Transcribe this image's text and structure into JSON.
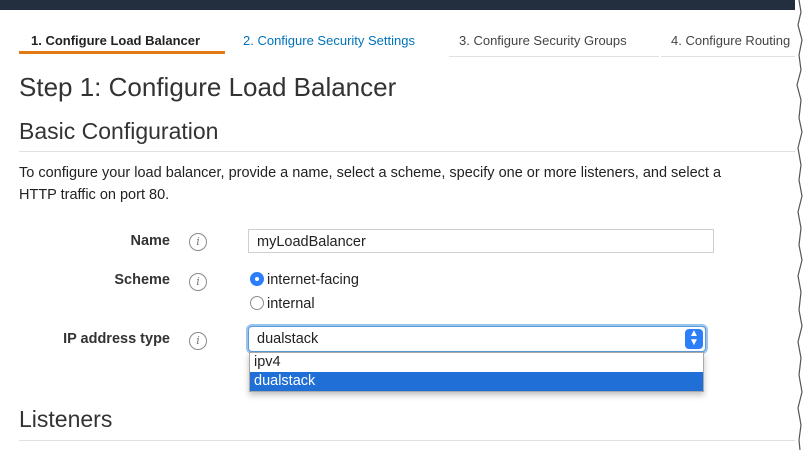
{
  "tabs": [
    {
      "label": "1. Configure Load Balancer",
      "state": "active"
    },
    {
      "label": "2. Configure Security Settings",
      "state": "link"
    },
    {
      "label": "3. Configure Security Groups",
      "state": "plain"
    },
    {
      "label": "4. Configure Routing",
      "state": "plain"
    }
  ],
  "page_title": "Step 1: Configure Load Balancer",
  "section_title": "Basic Configuration",
  "description_line1": "To configure your load balancer, provide a name, select a scheme, specify one or more listeners, and select a",
  "description_line2": "HTTP traffic on port 80.",
  "form": {
    "name_label": "Name",
    "name_value": "myLoadBalancer",
    "scheme_label": "Scheme",
    "scheme_options": [
      "internet-facing",
      "internal"
    ],
    "scheme_selected": "internet-facing",
    "ip_label": "IP address type",
    "ip_value": "dualstack",
    "ip_options": [
      "ipv4",
      "dualstack"
    ],
    "info_glyph": "i"
  },
  "listeners_title": "Listeners",
  "colors": {
    "accent": "#e47911",
    "link": "#0073bb",
    "select_highlight": "#1f6fd6",
    "topbar": "#232f3e"
  }
}
